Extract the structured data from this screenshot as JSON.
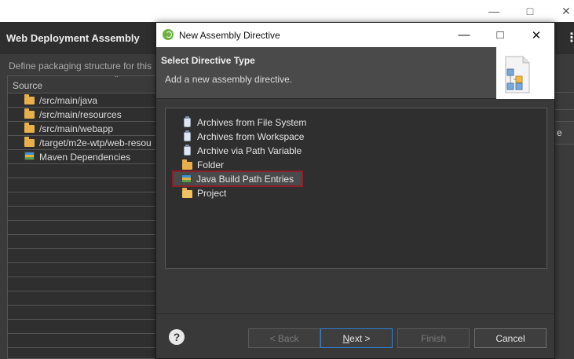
{
  "background_window": {
    "header_title": "Web Deployment Assembly",
    "description": "Define packaging structure for this",
    "table": {
      "column_source": "Source",
      "rows": [
        {
          "label": "/src/main/java",
          "icon": "folder-icon"
        },
        {
          "label": "/src/main/resources",
          "icon": "folder-icon"
        },
        {
          "label": "/src/main/webapp",
          "icon": "folder-icon"
        },
        {
          "label": "/target/m2e-wtp/web-resou",
          "icon": "folder-icon"
        },
        {
          "label": "Maven Dependencies",
          "icon": "library-icon"
        }
      ]
    },
    "right_button_fragment": "e"
  },
  "dialog": {
    "title": "New Assembly Directive",
    "banner_heading": "Select Directive Type",
    "banner_subtext": "Add a new assembly directive.",
    "directive_types": [
      {
        "label": "Archives from File System",
        "icon": "jar-icon",
        "selected": false
      },
      {
        "label": "Archives from Workspace",
        "icon": "jar-icon",
        "selected": false
      },
      {
        "label": "Archive via Path Variable",
        "icon": "jar-icon",
        "selected": false
      },
      {
        "label": "Folder",
        "icon": "folder-icon",
        "selected": false
      },
      {
        "label": "Java Build Path Entries",
        "icon": "library-icon",
        "selected": true
      },
      {
        "label": "Project",
        "icon": "project-icon",
        "selected": false
      }
    ],
    "buttons": {
      "back": "< Back",
      "next_mnemonic": "N",
      "next_rest": "ext >",
      "finish": "Finish",
      "cancel": "Cancel"
    }
  },
  "colors": {
    "selection_outline": "#8b1f2a",
    "default_button_border": "#2f7fd0",
    "spring_icon": "#6db33f"
  }
}
